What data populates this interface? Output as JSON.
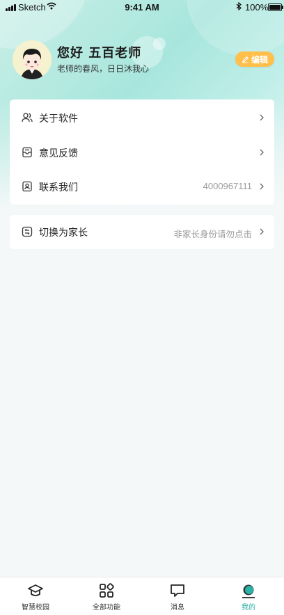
{
  "status_bar": {
    "carrier": "Sketch",
    "time": "9:41 AM",
    "battery": "100%"
  },
  "profile": {
    "name": "您好 五百老师",
    "motto": "老师的春风，日日沐我心",
    "edit_label": "编辑"
  },
  "menu": [
    {
      "label": "关于软件",
      "value": "",
      "icon": "users-icon"
    },
    {
      "label": "意见反馈",
      "value": "",
      "icon": "inbox-icon"
    },
    {
      "label": "联系我们",
      "value": "4000967111",
      "icon": "contact-card-icon"
    }
  ],
  "switch_role": {
    "label": "切换为家长",
    "hint": "非家长身份请勿点击",
    "icon": "swap-icon"
  },
  "tabbar": [
    {
      "label": "智慧校园",
      "icon": "graduation-cap-icon",
      "active": false
    },
    {
      "label": "全部功能",
      "icon": "grid-icon",
      "active": false
    },
    {
      "label": "消息",
      "icon": "message-icon",
      "active": false
    },
    {
      "label": "我的",
      "icon": "profile-icon",
      "active": true
    }
  ],
  "colors": {
    "accent": "#25a9a0",
    "edit_button": "#ffbf4a",
    "header_gradient": "#a8e6dd"
  }
}
